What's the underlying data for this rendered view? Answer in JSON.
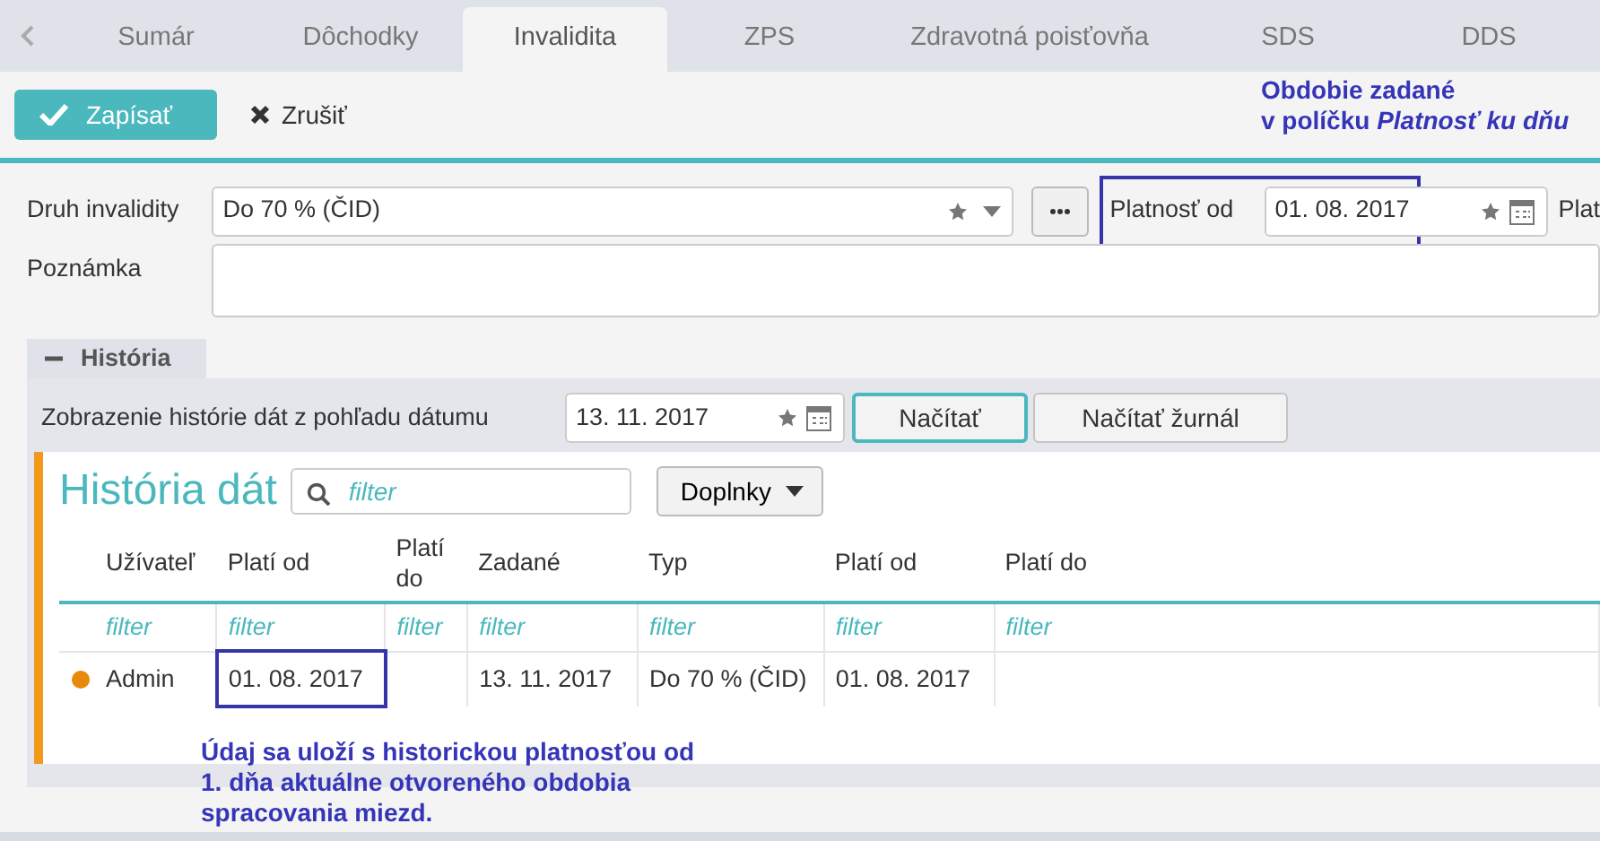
{
  "tabs": [
    {
      "label": "Sumár",
      "selected": false
    },
    {
      "label": "Dôchodky",
      "selected": false
    },
    {
      "label": "Invalidita",
      "selected": true
    },
    {
      "label": "ZPS",
      "selected": false
    },
    {
      "label": "Zdravotná poisťovňa",
      "selected": false
    },
    {
      "label": "SDS",
      "selected": false
    },
    {
      "label": "DDS",
      "selected": false
    }
  ],
  "toolbar": [
    {
      "label": "Zapísať",
      "kind": "primary"
    },
    {
      "label": "Zrušiť",
      "kind": "plain"
    }
  ],
  "top_note": {
    "lines": [
      "Obdobie zadané",
      "v políčku *Platnosť ku dňu*"
    ]
  },
  "form": {
    "druh_invalidity": {
      "label": "Druh invalidity",
      "value": "Do 70 % (ČID)"
    },
    "platnost_od": {
      "label": "Platnosť od",
      "value": "01. 08. 2017",
      "highlighted": true
    },
    "next_label": "Plat",
    "poznamka": {
      "label": "Poznámka"
    }
  },
  "history": {
    "header": "História",
    "expanded": true,
    "date_label": "Zobrazenie histórie dát z pohľadu dátumu",
    "date_value": "13. 11. 2017",
    "buttons": [
      {
        "label": "Načítať",
        "focused": true
      },
      {
        "label": "Načítať žurnál",
        "focused": false
      }
    ],
    "panel": {
      "title": "História dát",
      "search_placeholder": "filter",
      "menu_label": "Doplnky",
      "columns": [
        "Užívateľ",
        "Platí od",
        "Platí do",
        "Zadané",
        "Typ",
        "Platí od",
        "Platí do"
      ],
      "filters": [
        "filter",
        "filter",
        "filter",
        "filter",
        "filter",
        "filter",
        "filter"
      ],
      "rows": [
        {
          "color": "#e8890c",
          "cells": [
            {
              "text": "Admin",
              "highlighted": false
            },
            {
              "text": "01. 08. 2017",
              "highlighted": true
            },
            {
              "highlighted": false
            },
            {
              "text": "13. 11. 2017",
              "highlighted": false
            },
            {
              "text": "Do 70 % (ČID)",
              "highlighted": false
            },
            {
              "text": "01. 08. 2017",
              "highlighted": false
            },
            {
              "highlighted": false
            }
          ]
        }
      ]
    }
  },
  "bottom_note": {
    "lines": [
      "Údaj sa uloží s historickou platnosťou od",
      "1. dňa aktuálne otvoreného obdobia",
      "spracovania miezd."
    ]
  }
}
